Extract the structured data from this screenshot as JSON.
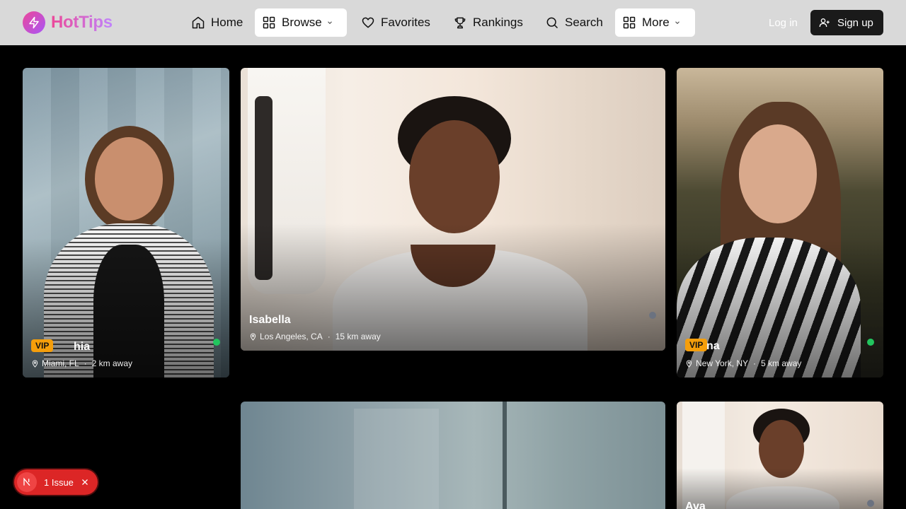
{
  "brand": {
    "name": "HotTips"
  },
  "nav": [
    {
      "label": "Home",
      "icon": "home-icon",
      "active": false
    },
    {
      "label": "Browse",
      "icon": "grid-icon",
      "active": true,
      "dropdown": true
    },
    {
      "label": "Favorites",
      "icon": "heart-icon",
      "active": false
    },
    {
      "label": "Rankings",
      "icon": "trophy-icon",
      "active": false
    },
    {
      "label": "Search",
      "icon": "search-icon",
      "active": false
    },
    {
      "label": "More",
      "icon": "grid-icon",
      "active": true,
      "dropdown": true
    }
  ],
  "auth": {
    "login": "Log in",
    "signup": "Sign up"
  },
  "cards": [
    {
      "name": "hia",
      "location": "Miami, FL",
      "distance": "2 km away",
      "vip": "VIP",
      "online": true
    },
    {
      "name": "Isabella",
      "location": "Los Angeles, CA",
      "distance": "15 km away",
      "vip": "",
      "online": false
    },
    {
      "name": "na",
      "location": "New York, NY",
      "distance": "5 km away",
      "vip": "VIP",
      "online": true
    },
    {
      "name": "",
      "location": "",
      "distance": "",
      "vip": "",
      "online": false
    },
    {
      "name": "Ava",
      "location": "",
      "distance": "",
      "vip": "",
      "online": false
    }
  ],
  "issue": {
    "label": "1 Issue"
  },
  "colors": {
    "accent": "#ec4899",
    "accent2": "#a855f7",
    "vip": "#f59e0b",
    "online": "#22c55e",
    "offline": "#6b7280",
    "issue": "#dc2626"
  }
}
